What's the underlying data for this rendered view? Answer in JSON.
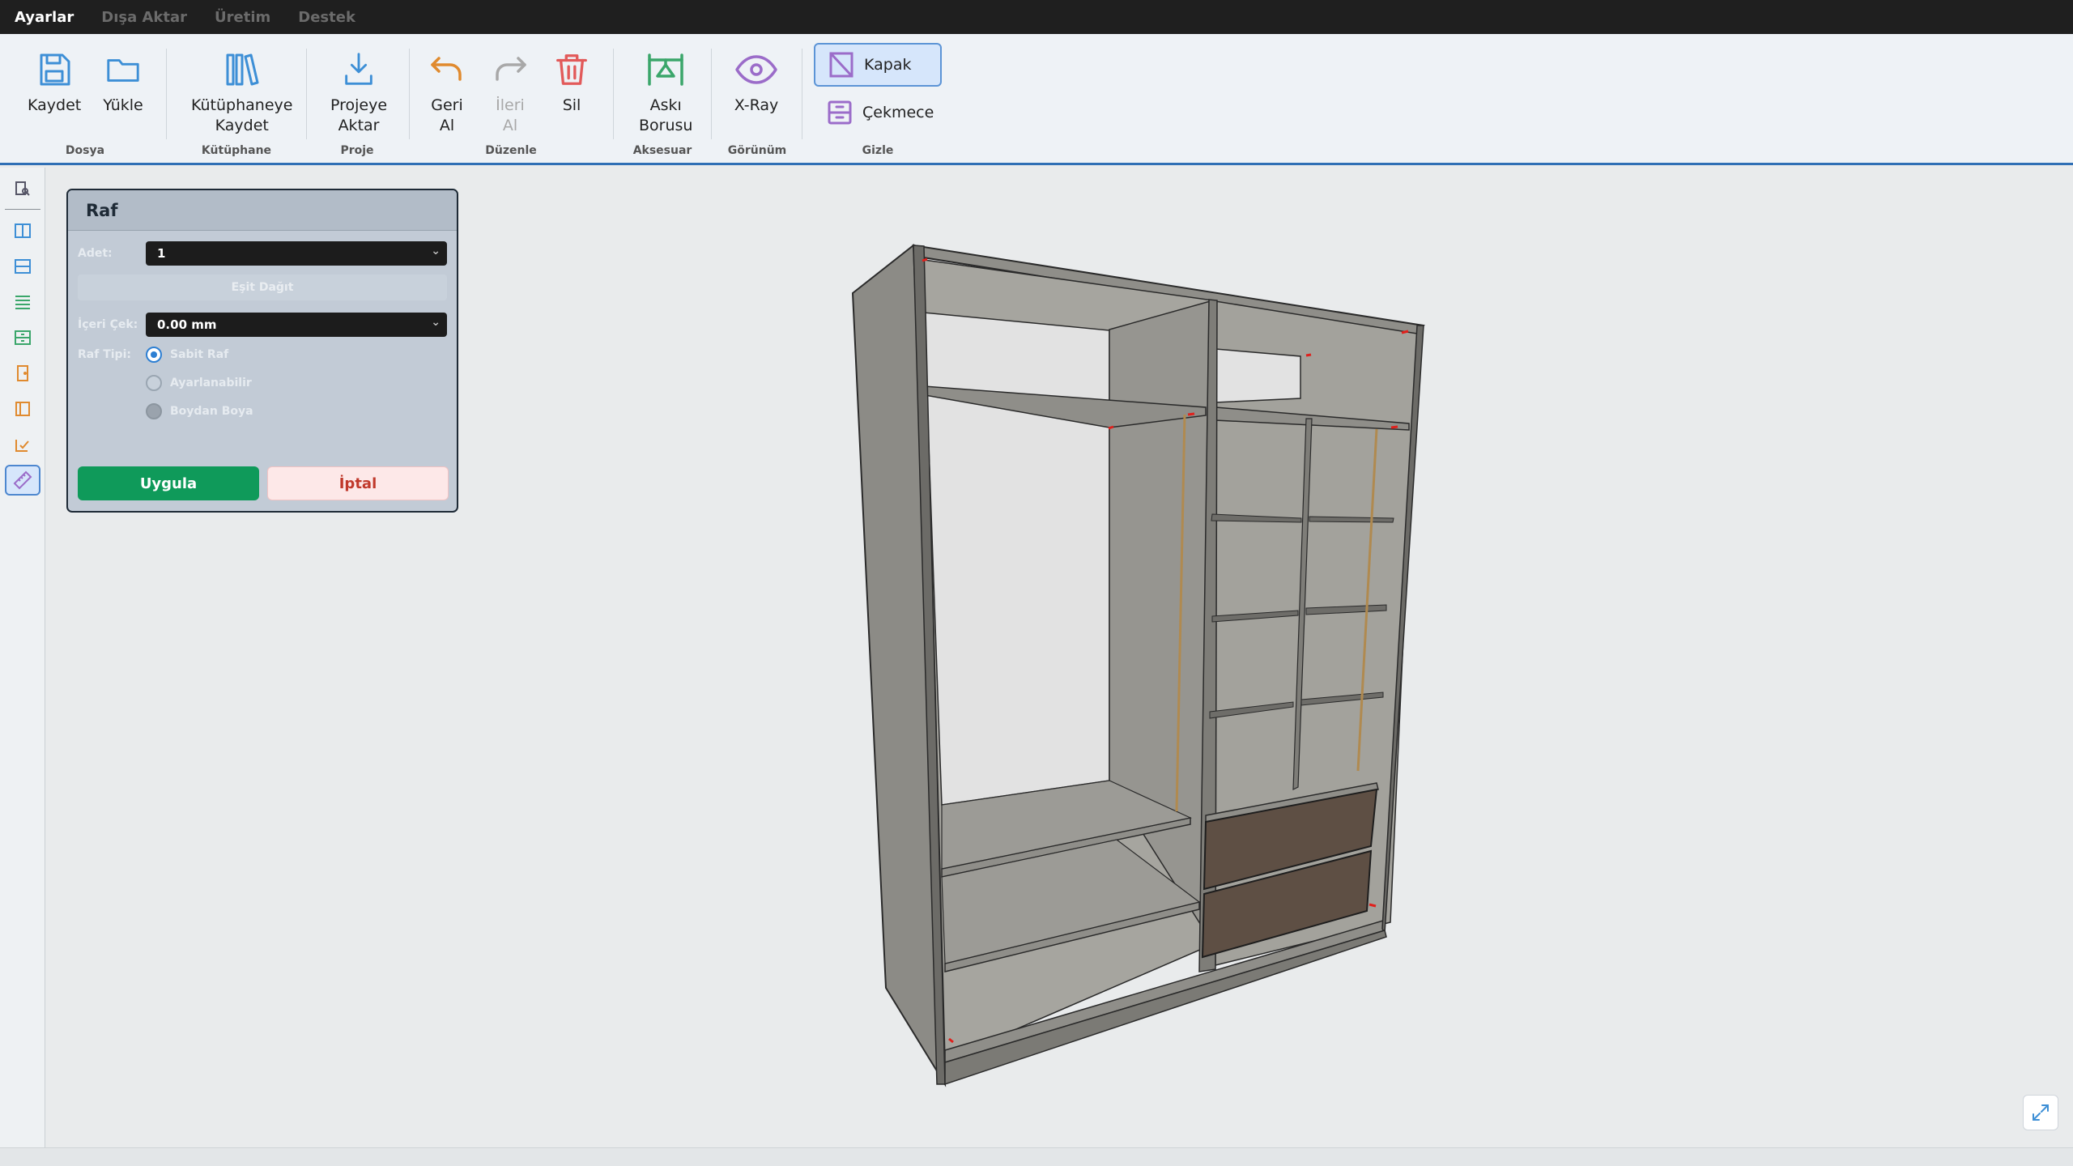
{
  "menubar": {
    "items": [
      "Ayarlar",
      "Dışa Aktar",
      "Üretim",
      "Destek"
    ]
  },
  "ribbon": {
    "groups": {
      "dosya": "Dosya",
      "kutuphane": "Kütüphane",
      "proje": "Proje",
      "duzenle": "Düzenle",
      "aksesuar": "Aksesuar",
      "gorunum": "Görünüm",
      "gizle": "Gizle"
    },
    "buttons": {
      "kaydet": "Kaydet",
      "yukle": "Yükle",
      "kutuphaneye_kaydet": "Kütüphaneye\nKaydet",
      "projeye_aktar": "Projeye\nAktar",
      "geri_al": "Geri\nAl",
      "ileri_al": "İleri\nAl",
      "sil": "Sil",
      "aski_borusu": "Askı\nBorusu",
      "xray": "X-Ray",
      "kapak": "Kapak",
      "cekmece": "Çekmece"
    }
  },
  "panel": {
    "title": "Raf",
    "adet_label": "Adet:",
    "adet_value": "1",
    "esit_dagit": "Eşit Dağıt",
    "iceri_cek_label": "İçeri Çek:",
    "iceri_cek_value": "0.00 mm",
    "raf_tipi_label": "Raf Tipi:",
    "raf_tipi_options": [
      "Sabit Raf",
      "Ayarlanabilir",
      "Boydan Boya"
    ],
    "apply": "Uygula",
    "cancel": "İptal"
  },
  "colors": {
    "accent": "#2f6fb5",
    "apply": "#0f9a5a",
    "cancel_text": "#c0392b",
    "icon_blue": "#3d8fd6",
    "icon_orange": "#e08a2e",
    "icon_red": "#e25a5a",
    "icon_green": "#3aa66a",
    "icon_purple": "#9b6cc9"
  },
  "icons": {
    "lefttools": [
      "cabinet-list-icon",
      "vertical-divider-icon",
      "horizontal-divider-icon",
      "shelves-icon",
      "drawer-icon",
      "door-icon",
      "panel-icon",
      "checklist-icon",
      "ruler-icon"
    ]
  }
}
